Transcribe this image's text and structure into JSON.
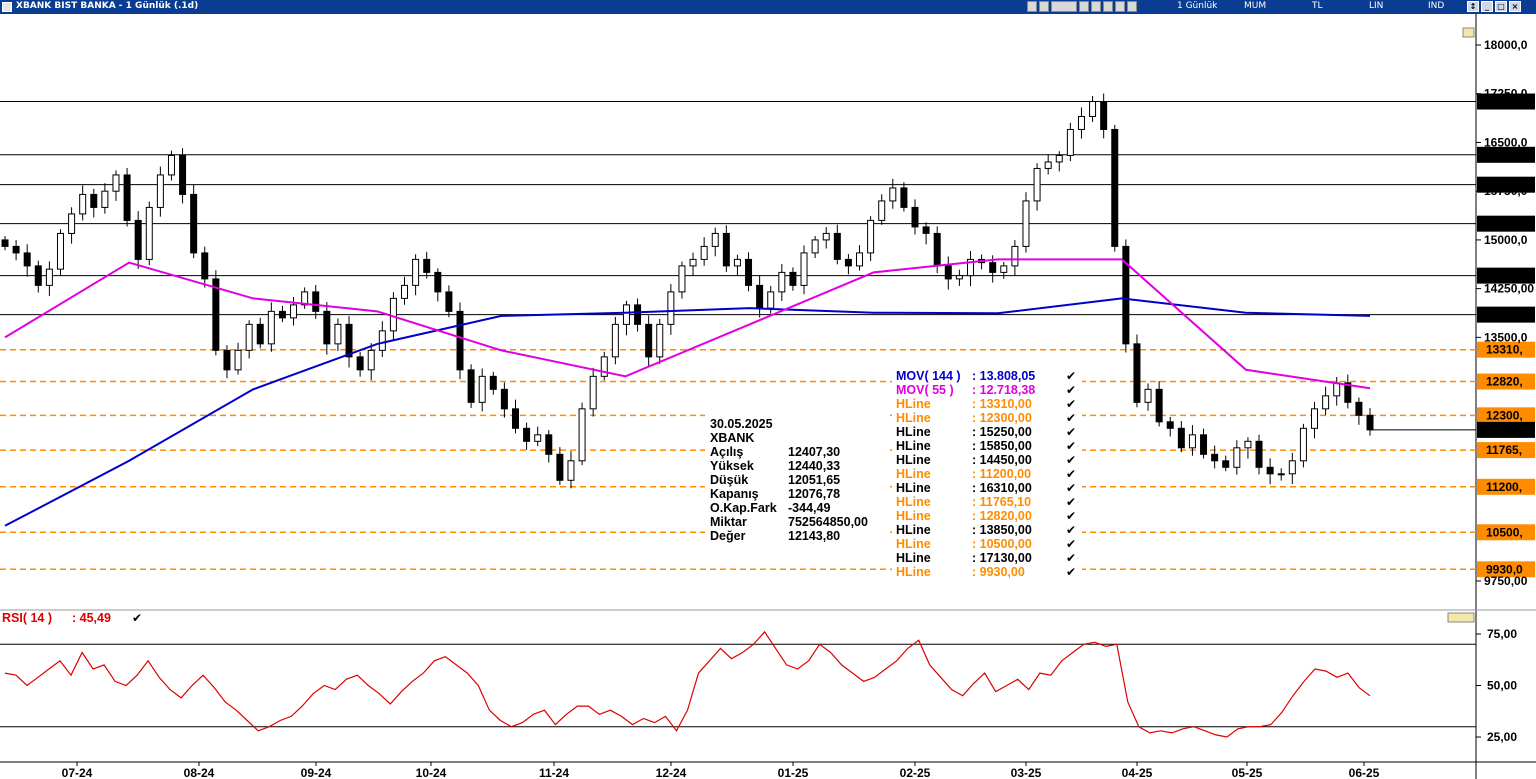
{
  "window": {
    "title": "XBANK BIST BANKA - 1 Günlük (.1d)",
    "period": "1 Günlük",
    "chart_style": "MUM",
    "currency": "TL",
    "scale": "LIN",
    "indicator_mode": "IND"
  },
  "info_box": {
    "date": "30.05.2025",
    "symbol": "XBANK",
    "rows": [
      {
        "label": "Açılış",
        "value": "12407,30"
      },
      {
        "label": "Yüksek",
        "value": "12440,33"
      },
      {
        "label": "Düşük",
        "value": "12051,65"
      },
      {
        "label": "Kapanış",
        "value": "12076,78"
      },
      {
        "label": "O.Kap.Fark",
        "value": "-344,49"
      },
      {
        "label": "Miktar",
        "value": "752564850,00"
      },
      {
        "label": "Değer",
        "value": "12143,80"
      }
    ]
  },
  "legend": [
    {
      "name": "MOV( 144 )",
      "value": ": 13.808,05",
      "color": "#0000cc"
    },
    {
      "name": "MOV( 55 )",
      "value": ": 12.718,38",
      "color": "#e000e0"
    },
    {
      "name": "HLine",
      "value": ": 13310,00",
      "color": "#ff8c00"
    },
    {
      "name": "HLine",
      "value": ": 12300,00",
      "color": "#ff8c00"
    },
    {
      "name": "HLine",
      "value": ": 15250,00",
      "color": "#000000"
    },
    {
      "name": "HLine",
      "value": ": 15850,00",
      "color": "#000000"
    },
    {
      "name": "HLine",
      "value": ": 14450,00",
      "color": "#000000"
    },
    {
      "name": "HLine",
      "value": ": 11200,00",
      "color": "#ff8c00"
    },
    {
      "name": "HLine",
      "value": ": 16310,00",
      "color": "#000000"
    },
    {
      "name": "HLine",
      "value": ": 11765,10",
      "color": "#ff8c00"
    },
    {
      "name": "HLine",
      "value": ": 12820,00",
      "color": "#ff8c00"
    },
    {
      "name": "HLine",
      "value": ": 13850,00",
      "color": "#000000"
    },
    {
      "name": "HLine",
      "value": ": 10500,00",
      "color": "#ff8c00"
    },
    {
      "name": "HLine",
      "value": ": 17130,00",
      "color": "#000000"
    },
    {
      "name": "HLine",
      "value": ": 9930,00",
      "color": "#ff8c00"
    }
  ],
  "rsi": {
    "label": "RSI( 14 )",
    "value": ": 45,49",
    "color": "#dd0000"
  },
  "chart_data": [
    {
      "type": "candlestick",
      "ylim": [
        9750,
        18200
      ],
      "y_ticks": [
        {
          "value": 9750,
          "label": "9750,00"
        },
        {
          "value": 13500,
          "label": "13500,0"
        },
        {
          "value": 14250,
          "label": "14250,00"
        },
        {
          "value": 15000,
          "label": "15000,0"
        },
        {
          "value": 15750,
          "label": "15750,0"
        },
        {
          "value": 16500,
          "label": "16500,0"
        },
        {
          "value": 17250,
          "label": "17250,0"
        },
        {
          "value": 18000,
          "label": "18000,0"
        }
      ],
      "x_tick_labels": [
        "07-24",
        "08-24",
        "09-24",
        "10-24",
        "11-24",
        "12-24",
        "01-25",
        "02-25",
        "03-25",
        "04-25",
        "05-25",
        "06-25"
      ],
      "hlines": [
        {
          "value": 17130,
          "label": "17130,",
          "style": "solid",
          "color": "#000000"
        },
        {
          "value": 16310,
          "label": "16310,",
          "style": "solid",
          "color": "#000000"
        },
        {
          "value": 15850,
          "label": "15850,",
          "style": "solid",
          "color": "#000000"
        },
        {
          "value": 15250,
          "label": "15250,",
          "style": "solid",
          "color": "#000000"
        },
        {
          "value": 14450,
          "label": "14450,",
          "style": "solid",
          "color": "#000000"
        },
        {
          "value": 13850,
          "label": "13850,",
          "style": "solid",
          "color": "#000000"
        },
        {
          "value": 13310,
          "label": "13310,",
          "style": "dashed",
          "color": "#ff8c00"
        },
        {
          "value": 12820,
          "label": "12820,",
          "style": "dashed",
          "color": "#ff8c00"
        },
        {
          "value": 12300,
          "label": "12300,",
          "style": "dashed",
          "color": "#ff8c00"
        },
        {
          "value": 11765,
          "label": "11765,",
          "style": "dashed",
          "color": "#ff8c00"
        },
        {
          "value": 11200,
          "label": "11200,",
          "style": "dashed",
          "color": "#ff8c00"
        },
        {
          "value": 10500,
          "label": "10500,",
          "style": "dashed",
          "color": "#ff8c00"
        },
        {
          "value": 9930,
          "label": "9930,0",
          "style": "dashed",
          "color": "#ff8c00"
        }
      ],
      "last_price": {
        "value": 12076,
        "label": "12076,"
      },
      "series": [
        {
          "name": "MOV( 144 )",
          "color": "#0000cc",
          "x": [
            "07-24",
            "08-24",
            "09-24",
            "10-24",
            "11-24",
            "12-24",
            "01-25",
            "02-25",
            "03-25",
            "04-25",
            "05-25",
            "06-25"
          ],
          "values": [
            10600,
            11600,
            12700,
            13400,
            13830,
            13880,
            13950,
            13880,
            13870,
            14100,
            13880,
            13830
          ]
        },
        {
          "name": "MOV( 55 )",
          "color": "#e000e0",
          "x": [
            "07-24",
            "08-24",
            "09-24",
            "10-24",
            "11-24",
            "12-24",
            "01-25",
            "02-25",
            "03-25",
            "04-25",
            "05-25",
            "06-25"
          ],
          "values": [
            13500,
            14650,
            14100,
            13900,
            13300,
            12900,
            13700,
            14500,
            14700,
            14700,
            13000,
            12718
          ]
        }
      ],
      "candles_close": [
        14900,
        14800,
        14600,
        14300,
        14550,
        15100,
        15400,
        15700,
        15500,
        15750,
        16000,
        15300,
        14700,
        15500,
        16000,
        16300,
        15700,
        14800,
        14400,
        13300,
        13000,
        13300,
        13700,
        13400,
        13900,
        13800,
        14000,
        14200,
        13900,
        13400,
        13700,
        13200,
        13000,
        13300,
        13600,
        14100,
        14300,
        14700,
        14500,
        14200,
        13900,
        13000,
        12500,
        12900,
        12700,
        12400,
        12100,
        11900,
        12000,
        11700,
        11300,
        11600,
        12400,
        12900,
        13200,
        13700,
        14000,
        13700,
        13200,
        13700,
        14200,
        14600,
        14700,
        14900,
        15100,
        14600,
        14700,
        14300,
        13950,
        14200,
        14500,
        14300,
        14800,
        15000,
        15100,
        14700,
        14600,
        14800,
        15300,
        15600,
        15800,
        15500,
        15200,
        15100,
        14600,
        14400,
        14450,
        14700,
        14650,
        14500,
        14600,
        14900,
        15600,
        16100,
        16200,
        16300,
        16700,
        16900,
        17130,
        16700,
        14900,
        13400,
        12500,
        12700,
        12200,
        12100,
        11800,
        12000,
        11700,
        11600,
        11500,
        11800,
        11900,
        11500,
        11400,
        11400,
        11600,
        12100,
        12400,
        12600,
        12800,
        12500,
        12300,
        12076
      ]
    },
    {
      "type": "line",
      "ylim": [
        20,
        80
      ],
      "y_ticks": [
        {
          "value": 25,
          "label": "25,00"
        },
        {
          "value": 50,
          "label": "50,00"
        },
        {
          "value": 75,
          "label": "75,00"
        }
      ],
      "hlines": [
        30,
        70
      ],
      "series": [
        {
          "name": "RSI( 14 )",
          "color": "#dd0000",
          "values": [
            56,
            55,
            50,
            54,
            58,
            62,
            55,
            66,
            58,
            60,
            52,
            50,
            55,
            62,
            54,
            48,
            44,
            50,
            55,
            49,
            42,
            38,
            33,
            28,
            30,
            33,
            35,
            40,
            46,
            50,
            48,
            53,
            55,
            50,
            46,
            41,
            47,
            52,
            56,
            62,
            64,
            60,
            56,
            50,
            38,
            33,
            30,
            32,
            36,
            38,
            31,
            36,
            40,
            40,
            36,
            38,
            35,
            31,
            34,
            32,
            35,
            28,
            38,
            56,
            62,
            68,
            63,
            66,
            70,
            76,
            68,
            60,
            58,
            62,
            70,
            66,
            60,
            56,
            52,
            54,
            58,
            62,
            68,
            72,
            60,
            54,
            48,
            45,
            51,
            56,
            47,
            50,
            53,
            48,
            56,
            55,
            62,
            66,
            70,
            71,
            69,
            70,
            42,
            30,
            27,
            28,
            27,
            29,
            30,
            28,
            26,
            25,
            29,
            30,
            30,
            31,
            37,
            45,
            52,
            58,
            57,
            54,
            56,
            49,
            45
          ]
        }
      ]
    }
  ]
}
